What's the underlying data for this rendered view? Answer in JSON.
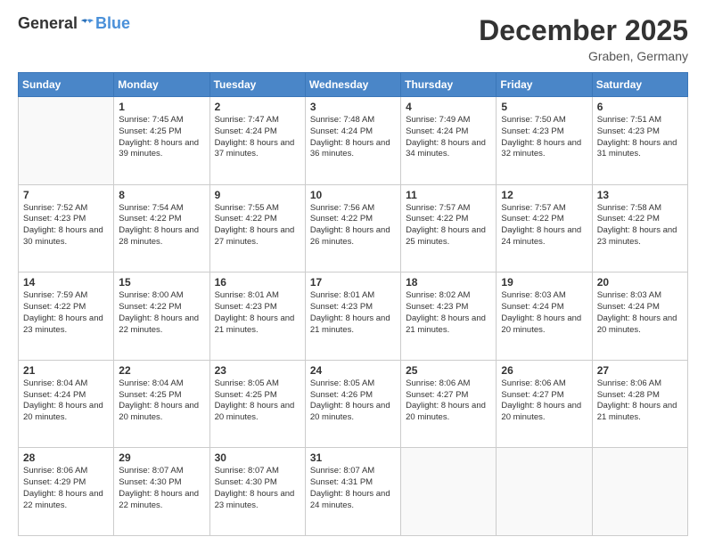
{
  "header": {
    "logo": {
      "general": "General",
      "blue": "Blue"
    },
    "title": "December 2025",
    "location": "Graben, Germany"
  },
  "calendar": {
    "days_of_week": [
      "Sunday",
      "Monday",
      "Tuesday",
      "Wednesday",
      "Thursday",
      "Friday",
      "Saturday"
    ],
    "weeks": [
      [
        {
          "day": "",
          "sunrise": "",
          "sunset": "",
          "daylight": ""
        },
        {
          "day": "1",
          "sunrise": "Sunrise: 7:45 AM",
          "sunset": "Sunset: 4:25 PM",
          "daylight": "Daylight: 8 hours and 39 minutes."
        },
        {
          "day": "2",
          "sunrise": "Sunrise: 7:47 AM",
          "sunset": "Sunset: 4:24 PM",
          "daylight": "Daylight: 8 hours and 37 minutes."
        },
        {
          "day": "3",
          "sunrise": "Sunrise: 7:48 AM",
          "sunset": "Sunset: 4:24 PM",
          "daylight": "Daylight: 8 hours and 36 minutes."
        },
        {
          "day": "4",
          "sunrise": "Sunrise: 7:49 AM",
          "sunset": "Sunset: 4:24 PM",
          "daylight": "Daylight: 8 hours and 34 minutes."
        },
        {
          "day": "5",
          "sunrise": "Sunrise: 7:50 AM",
          "sunset": "Sunset: 4:23 PM",
          "daylight": "Daylight: 8 hours and 32 minutes."
        },
        {
          "day": "6",
          "sunrise": "Sunrise: 7:51 AM",
          "sunset": "Sunset: 4:23 PM",
          "daylight": "Daylight: 8 hours and 31 minutes."
        }
      ],
      [
        {
          "day": "7",
          "sunrise": "Sunrise: 7:52 AM",
          "sunset": "Sunset: 4:23 PM",
          "daylight": "Daylight: 8 hours and 30 minutes."
        },
        {
          "day": "8",
          "sunrise": "Sunrise: 7:54 AM",
          "sunset": "Sunset: 4:22 PM",
          "daylight": "Daylight: 8 hours and 28 minutes."
        },
        {
          "day": "9",
          "sunrise": "Sunrise: 7:55 AM",
          "sunset": "Sunset: 4:22 PM",
          "daylight": "Daylight: 8 hours and 27 minutes."
        },
        {
          "day": "10",
          "sunrise": "Sunrise: 7:56 AM",
          "sunset": "Sunset: 4:22 PM",
          "daylight": "Daylight: 8 hours and 26 minutes."
        },
        {
          "day": "11",
          "sunrise": "Sunrise: 7:57 AM",
          "sunset": "Sunset: 4:22 PM",
          "daylight": "Daylight: 8 hours and 25 minutes."
        },
        {
          "day": "12",
          "sunrise": "Sunrise: 7:57 AM",
          "sunset": "Sunset: 4:22 PM",
          "daylight": "Daylight: 8 hours and 24 minutes."
        },
        {
          "day": "13",
          "sunrise": "Sunrise: 7:58 AM",
          "sunset": "Sunset: 4:22 PM",
          "daylight": "Daylight: 8 hours and 23 minutes."
        }
      ],
      [
        {
          "day": "14",
          "sunrise": "Sunrise: 7:59 AM",
          "sunset": "Sunset: 4:22 PM",
          "daylight": "Daylight: 8 hours and 23 minutes."
        },
        {
          "day": "15",
          "sunrise": "Sunrise: 8:00 AM",
          "sunset": "Sunset: 4:22 PM",
          "daylight": "Daylight: 8 hours and 22 minutes."
        },
        {
          "day": "16",
          "sunrise": "Sunrise: 8:01 AM",
          "sunset": "Sunset: 4:23 PM",
          "daylight": "Daylight: 8 hours and 21 minutes."
        },
        {
          "day": "17",
          "sunrise": "Sunrise: 8:01 AM",
          "sunset": "Sunset: 4:23 PM",
          "daylight": "Daylight: 8 hours and 21 minutes."
        },
        {
          "day": "18",
          "sunrise": "Sunrise: 8:02 AM",
          "sunset": "Sunset: 4:23 PM",
          "daylight": "Daylight: 8 hours and 21 minutes."
        },
        {
          "day": "19",
          "sunrise": "Sunrise: 8:03 AM",
          "sunset": "Sunset: 4:24 PM",
          "daylight": "Daylight: 8 hours and 20 minutes."
        },
        {
          "day": "20",
          "sunrise": "Sunrise: 8:03 AM",
          "sunset": "Sunset: 4:24 PM",
          "daylight": "Daylight: 8 hours and 20 minutes."
        }
      ],
      [
        {
          "day": "21",
          "sunrise": "Sunrise: 8:04 AM",
          "sunset": "Sunset: 4:24 PM",
          "daylight": "Daylight: 8 hours and 20 minutes."
        },
        {
          "day": "22",
          "sunrise": "Sunrise: 8:04 AM",
          "sunset": "Sunset: 4:25 PM",
          "daylight": "Daylight: 8 hours and 20 minutes."
        },
        {
          "day": "23",
          "sunrise": "Sunrise: 8:05 AM",
          "sunset": "Sunset: 4:25 PM",
          "daylight": "Daylight: 8 hours and 20 minutes."
        },
        {
          "day": "24",
          "sunrise": "Sunrise: 8:05 AM",
          "sunset": "Sunset: 4:26 PM",
          "daylight": "Daylight: 8 hours and 20 minutes."
        },
        {
          "day": "25",
          "sunrise": "Sunrise: 8:06 AM",
          "sunset": "Sunset: 4:27 PM",
          "daylight": "Daylight: 8 hours and 20 minutes."
        },
        {
          "day": "26",
          "sunrise": "Sunrise: 8:06 AM",
          "sunset": "Sunset: 4:27 PM",
          "daylight": "Daylight: 8 hours and 20 minutes."
        },
        {
          "day": "27",
          "sunrise": "Sunrise: 8:06 AM",
          "sunset": "Sunset: 4:28 PM",
          "daylight": "Daylight: 8 hours and 21 minutes."
        }
      ],
      [
        {
          "day": "28",
          "sunrise": "Sunrise: 8:06 AM",
          "sunset": "Sunset: 4:29 PM",
          "daylight": "Daylight: 8 hours and 22 minutes."
        },
        {
          "day": "29",
          "sunrise": "Sunrise: 8:07 AM",
          "sunset": "Sunset: 4:30 PM",
          "daylight": "Daylight: 8 hours and 22 minutes."
        },
        {
          "day": "30",
          "sunrise": "Sunrise: 8:07 AM",
          "sunset": "Sunset: 4:30 PM",
          "daylight": "Daylight: 8 hours and 23 minutes."
        },
        {
          "day": "31",
          "sunrise": "Sunrise: 8:07 AM",
          "sunset": "Sunset: 4:31 PM",
          "daylight": "Daylight: 8 hours and 24 minutes."
        },
        {
          "day": "",
          "sunrise": "",
          "sunset": "",
          "daylight": ""
        },
        {
          "day": "",
          "sunrise": "",
          "sunset": "",
          "daylight": ""
        },
        {
          "day": "",
          "sunrise": "",
          "sunset": "",
          "daylight": ""
        }
      ]
    ]
  }
}
